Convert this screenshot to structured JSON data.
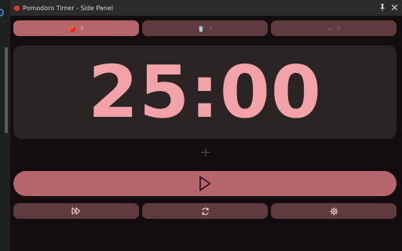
{
  "window": {
    "title": "Pomodoro Timer - Side Panel"
  },
  "tabs": [
    {
      "icon": "tomato-icon",
      "glyph": "🍅",
      "count": "0",
      "active": true
    },
    {
      "icon": "cup-icon",
      "glyph": "🥤",
      "count": "0",
      "active": false
    },
    {
      "icon": "coffee-icon",
      "glyph": "☕",
      "count": "0",
      "active": false
    }
  ],
  "timer": {
    "display": "25:00"
  },
  "add": {
    "glyph": "+"
  },
  "colors": {
    "accent": "#b6666b",
    "muted_button": "#5f3a3e",
    "timer_text": "#f3a3a8",
    "panel_bg": "#140d0f",
    "timer_bg": "#2b2424"
  },
  "controls": [
    "skip-forward-icon",
    "reset-icon",
    "settings-icon"
  ]
}
